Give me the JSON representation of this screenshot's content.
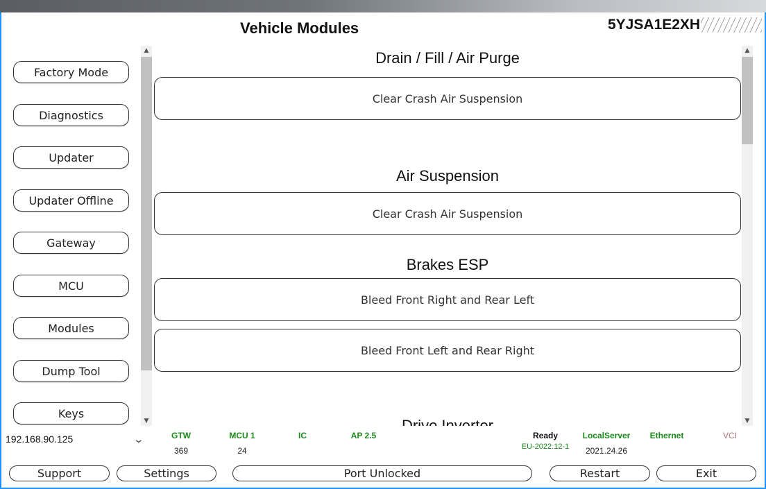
{
  "header": {
    "title": "Vehicle Modules",
    "vin_visible": "5YJSA1E2XH"
  },
  "sidebar": {
    "items": [
      {
        "label": "Factory Mode"
      },
      {
        "label": "Diagnostics"
      },
      {
        "label": "Updater"
      },
      {
        "label": "Updater Offline"
      },
      {
        "label": "Gateway"
      },
      {
        "label": "MCU"
      },
      {
        "label": "Modules"
      },
      {
        "label": "Dump Tool"
      },
      {
        "label": "Keys"
      }
    ]
  },
  "content": {
    "sections": [
      {
        "title": "Drain / Fill / Air Purge",
        "buttons": [
          "Clear Crash Air Suspension"
        ]
      },
      {
        "title": "Air Suspension",
        "buttons": [
          "Clear Crash Air Suspension"
        ]
      },
      {
        "title": "Brakes ESP",
        "buttons": [
          "Bleed Front Right and Rear Left",
          "Bleed Front Left and Rear Right"
        ]
      },
      {
        "title": "Drive Inverter",
        "buttons": []
      }
    ]
  },
  "connection": {
    "ip": "192.168.90.125",
    "icons": {
      "dropdown": "chevron-down-icon"
    }
  },
  "status_bar": {
    "gtw": {
      "label": "GTW",
      "value": "369"
    },
    "mcu": {
      "label": "MCU 1",
      "value": "24"
    },
    "ic": {
      "label": "IC"
    },
    "ap": {
      "label": "AP 2.5"
    },
    "ready": {
      "label": "Ready",
      "value": "EU-2022.12-1"
    },
    "local_server": {
      "label": "LocalServer",
      "value": "2021.24.26"
    },
    "ethernet": {
      "label": "Ethernet"
    },
    "vci": {
      "label": "VCI"
    }
  },
  "footer": {
    "support": "Support",
    "settings": "Settings",
    "port": "Port Unlocked",
    "restart": "Restart",
    "exit": "Exit"
  },
  "colors": {
    "status_ok": "#1a8a1a",
    "status_off": "#b07070",
    "window_border": "#1e90ff"
  }
}
